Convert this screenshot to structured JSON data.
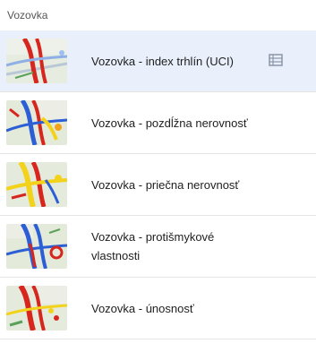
{
  "panel": {
    "section_title": "Vozovka",
    "items": [
      {
        "label": "Vozovka - index trhlín (UCI)",
        "selected": true,
        "icon": "table-icon"
      },
      {
        "label": "Vozovka - pozdĺžna nerovnosť",
        "selected": false
      },
      {
        "label": "Vozovka - priečna nerovnosť",
        "selected": false
      },
      {
        "label": "Vozovka - protišmykové vlastnosti",
        "selected": false
      },
      {
        "label": "Vozovka - únosnosť",
        "selected": false
      }
    ]
  },
  "colors": {
    "selected_bg": "#e9f0fb",
    "map_bg": "#dfe9d7",
    "road_red": "#d7261e",
    "road_yellow": "#f2d21b",
    "road_blue": "#2c5fd6",
    "table_icon": "#8a96a8"
  }
}
